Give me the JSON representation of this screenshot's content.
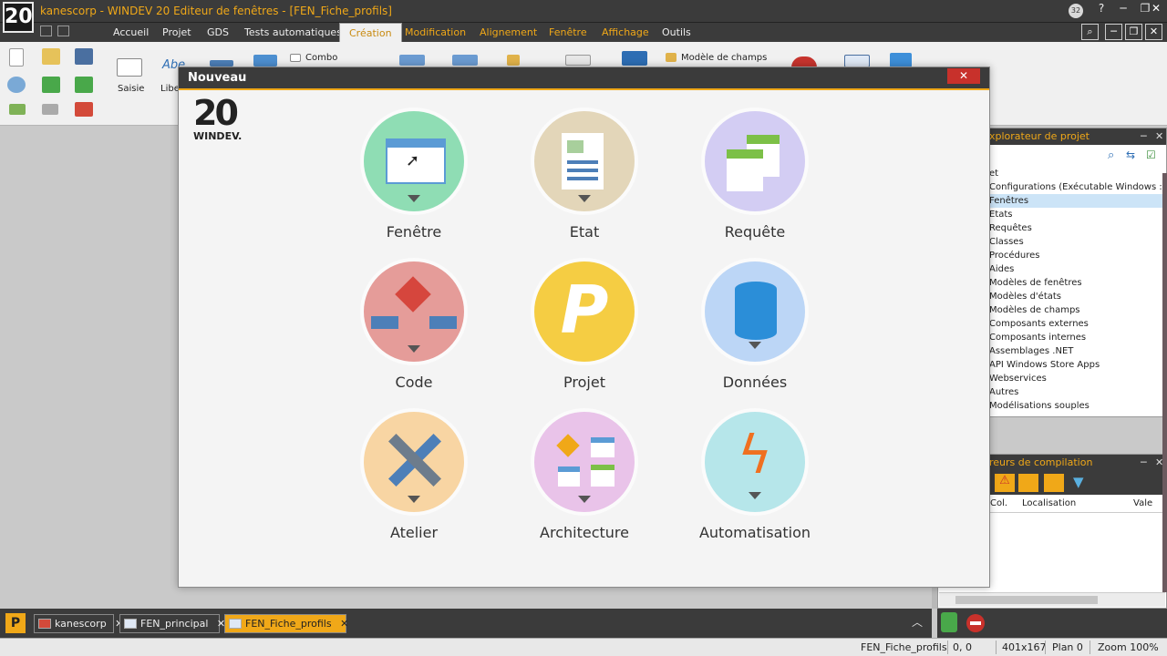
{
  "app": {
    "logo_text": "20",
    "title": "kanescorp - WINDEV 20  Editeur de fenêtres - [FEN_Fiche_profils]",
    "notification_count": "32"
  },
  "menu": {
    "items": [
      "Accueil",
      "Projet",
      "GDS",
      "Tests automatiques",
      "Création",
      "Modification",
      "Alignement",
      "Fenêtre",
      "Affichage",
      "Outils"
    ],
    "active": "Création"
  },
  "ribbon": {
    "saisie": "Saisie",
    "libelle_abbr": "Abe",
    "libelle": "Libe",
    "combo": "Combo",
    "modele_champs": "Modèle de champs"
  },
  "dialog": {
    "title": "Nouveau",
    "close_glyph": "✕",
    "logo_number": "20",
    "logo_word": "WINDEV.",
    "tiles": [
      {
        "label": "Fenêtre",
        "color": "#8fddb4"
      },
      {
        "label": "Etat",
        "color": "#e3d6b9"
      },
      {
        "label": "Requête",
        "color": "#d3cdf3"
      },
      {
        "label": "Code",
        "color": "#e59c99"
      },
      {
        "label": "Projet",
        "color": "#f5cd43"
      },
      {
        "label": "Données",
        "color": "#bcd6f6"
      },
      {
        "label": "Atelier",
        "color": "#f8d5a3"
      },
      {
        "label": "Architecture",
        "color": "#e9c3e9"
      },
      {
        "label": "Automatisation",
        "color": "#b6e6ea"
      }
    ],
    "projet_letter": "P"
  },
  "explorer": {
    "title": "xplorateur de projet",
    "items": [
      "et",
      "Configurations (Exécutable Windows :",
      "Fenêtres",
      "Etats",
      "Requêtes",
      "Classes",
      "Procédures",
      "Aides",
      "Modèles de fenêtres",
      "Modèles d'états",
      "Modèles de champs",
      "Composants externes",
      "Composants internes",
      "Assemblages .NET",
      "API Windows Store Apps",
      "Webservices",
      "Autres",
      "Modélisations souples"
    ],
    "selected": "Fenêtres"
  },
  "compile": {
    "title": "reurs de compilation",
    "columns": [
      "Col.",
      "Localisation",
      "Vale"
    ]
  },
  "taskbar": {
    "tabs": [
      {
        "label": "kanescorp",
        "active": false
      },
      {
        "label": "FEN_principal",
        "active": false
      },
      {
        "label": "FEN_Fiche_profils",
        "active": true
      }
    ],
    "close_glyph": "✕"
  },
  "statusbar": {
    "window_name": "FEN_Fiche_profils",
    "position": "0, 0",
    "size": "401x167",
    "plan": "Plan 0",
    "zoom": "Zoom 100%"
  },
  "colors": {
    "accent": "#f0a818",
    "dark": "#3b3b3b",
    "close_red": "#c8312b"
  }
}
